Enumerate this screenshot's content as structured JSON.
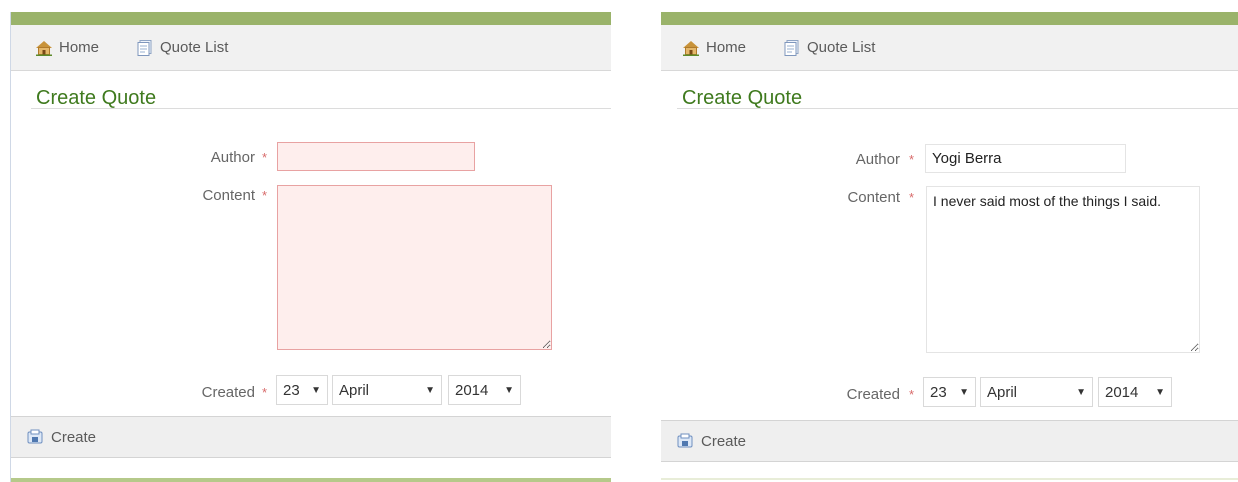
{
  "nav": {
    "home_label": "Home",
    "quote_list_label": "Quote List"
  },
  "page": {
    "title": "Create Quote"
  },
  "form": {
    "author_label": "Author",
    "content_label": "Content",
    "created_label": "Created",
    "required_marker": "*",
    "day": "23",
    "month": "April",
    "year": "2014",
    "create_label": "Create"
  },
  "left_panel": {
    "author_value": "",
    "content_value": "",
    "state": "validation-error"
  },
  "right_panel": {
    "author_value": "Yogi Berra",
    "content_value": "I never said most of the things I said.",
    "state": "filled"
  },
  "colors": {
    "accent_green": "#9ab36a",
    "title_green": "#3f7a1e",
    "error_fill": "#feeeed",
    "error_border": "#e8a2a2",
    "required_red": "#d86a6a"
  },
  "icons": {
    "home": "home-icon",
    "quote_list": "document-icon",
    "create": "create-icon"
  }
}
